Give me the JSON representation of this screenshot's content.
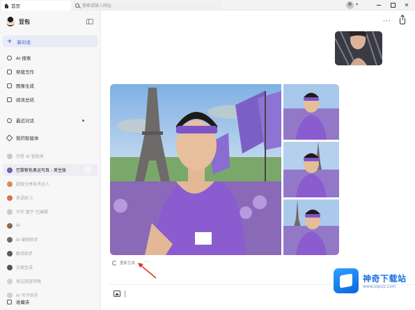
{
  "window": {
    "tab_title": "首页",
    "address_text": "搜索或输入网址",
    "close_glyph": "✕"
  },
  "sidebar": {
    "app_name": "豆包",
    "new_chat_label": "新对话",
    "nav": [
      {
        "label": "AI 搜索",
        "icon": "search-icon"
      },
      {
        "label": "帮我写作",
        "icon": "pen-icon"
      },
      {
        "label": "图像生成",
        "icon": "image-icon"
      },
      {
        "label": "阅读总结",
        "icon": "book-icon"
      }
    ],
    "recent_label": "最近对话",
    "agents_label": "我的智能体",
    "conversations": [
      {
        "label": "问答 AI 智能体",
        "active": false,
        "blur": true,
        "color": "#c7c7cc"
      },
      {
        "label": "巴黎紫色奥运写真 - 男生版",
        "active": true,
        "blur": false,
        "color": "#7a5cb0"
      },
      {
        "label": "超级分享技术达人",
        "active": false,
        "blur": true,
        "color": "#d98c5f"
      },
      {
        "label": "英语练习",
        "active": false,
        "blur": true,
        "color": "#d6704d"
      },
      {
        "label": "写作 基于 已编辑",
        "active": false,
        "blur": true,
        "color": "#c9c9cf"
      },
      {
        "label": "AI",
        "active": false,
        "blur": true,
        "color": "#8c6b4f"
      },
      {
        "label": "AI 编程助手",
        "active": false,
        "blur": true,
        "color": "#6b6b6b"
      },
      {
        "label": "翻译助手",
        "active": false,
        "blur": true,
        "color": "#5a5a5a"
      },
      {
        "label": "文案生成",
        "active": false,
        "blur": true,
        "color": "#555"
      },
      {
        "label": "周边旅游攻略",
        "active": false,
        "blur": true,
        "color": "#d0d0d5"
      },
      {
        "label": "AI 写作助手",
        "active": false,
        "blur": true,
        "color": "#d0d0d5"
      }
    ],
    "favorites_label": "收藏夹"
  },
  "main": {
    "more_label": "···",
    "regenerate_label": "重新生成",
    "regen_more_label": "···",
    "input_placeholder": ""
  },
  "watermark": {
    "title": "神奇下载站",
    "url": "www.sqxzz.com"
  },
  "colors": {
    "accent": "#3c6cf0",
    "arrow": "#d8352a",
    "shirt": "#8a5cd0"
  }
}
